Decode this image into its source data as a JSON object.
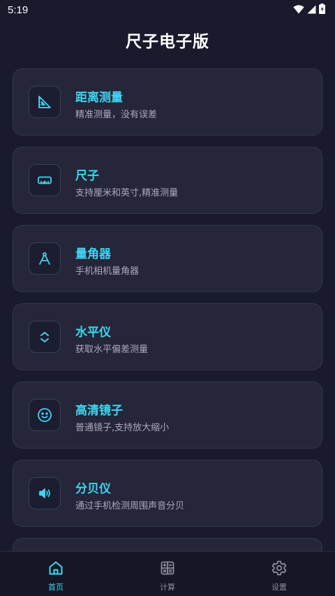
{
  "status_bar": {
    "time": "5:19",
    "icons": [
      "wifi-icon",
      "signal-icon",
      "battery-icon"
    ]
  },
  "header": {
    "title": "尺子电子版"
  },
  "colors": {
    "accent": "#3fd5f0",
    "background": "#191a2c",
    "card": "#252639"
  },
  "features": [
    {
      "title": "距离测量",
      "desc": "精准测量，没有误差",
      "icon": "set-square-icon"
    },
    {
      "title": "尺子",
      "desc": "支持厘米和英寸,精准测量",
      "icon": "ruler-icon"
    },
    {
      "title": "量角器",
      "desc": "手机相机量角器",
      "icon": "compass-icon"
    },
    {
      "title": "水平仪",
      "desc": "获取水平偏差测量",
      "icon": "level-icon"
    },
    {
      "title": "高清镜子",
      "desc": "普通镜子,支持放大缩小",
      "icon": "smiley-icon"
    },
    {
      "title": "分贝仪",
      "desc": "通过手机检测周围声音分贝",
      "icon": "speaker-icon"
    }
  ],
  "bottom_nav": [
    {
      "label": "首页",
      "icon": "home-icon",
      "active": true
    },
    {
      "label": "计算",
      "icon": "calculator-icon",
      "active": false
    },
    {
      "label": "设置",
      "icon": "gear-icon",
      "active": false
    }
  ]
}
